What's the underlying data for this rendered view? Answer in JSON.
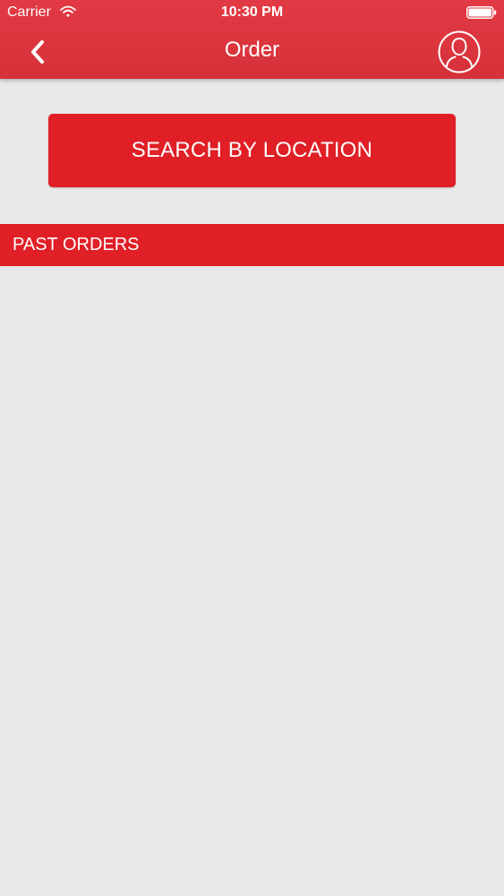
{
  "status_bar": {
    "carrier": "Carrier",
    "time": "10:30 PM",
    "wifi_icon": "wifi-icon",
    "battery_icon": "battery-icon"
  },
  "nav": {
    "title": "Order",
    "back_icon": "chevron-left-icon",
    "profile_icon": "user-circle-icon"
  },
  "main": {
    "search_button_label": "SEARCH BY LOCATION",
    "past_orders_header": "PAST ORDERS",
    "past_orders": []
  },
  "colors": {
    "brand_red": "#e01f26",
    "header_red": "#dc343c",
    "background": "#e9e9ea",
    "text_on_brand": "#ffffff"
  }
}
